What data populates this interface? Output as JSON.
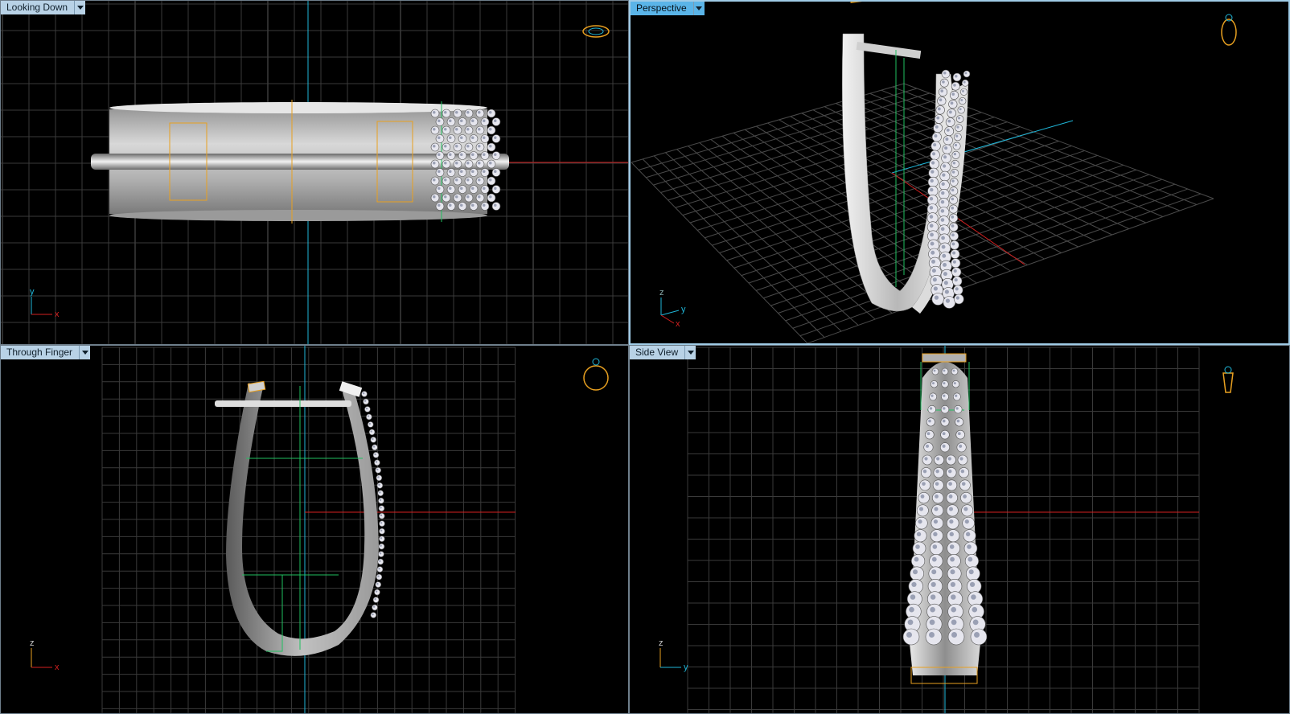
{
  "viewports": [
    {
      "id": "top",
      "label": "Looking Down",
      "axes": {
        "h": "x",
        "v": "y"
      }
    },
    {
      "id": "perspective",
      "label": "Perspective",
      "axes": {
        "a": "z",
        "b": "y",
        "c": "x"
      }
    },
    {
      "id": "front",
      "label": "Through Finger",
      "axes": {
        "h": "x",
        "v": "z"
      }
    },
    {
      "id": "side",
      "label": "Side View",
      "axes": {
        "h": "y",
        "v": "z"
      }
    }
  ],
  "active_viewport": "perspective",
  "colors": {
    "grid": "#3b3b3b",
    "grid_major": "#6a6a6a",
    "x_axis": "#d42020",
    "y_axis": "#1fb6d8",
    "z_axis": "#20c060",
    "selection": "#e8a020",
    "metal": "#c8c8c8"
  },
  "icons": [
    "ring-view-cube-icon"
  ]
}
